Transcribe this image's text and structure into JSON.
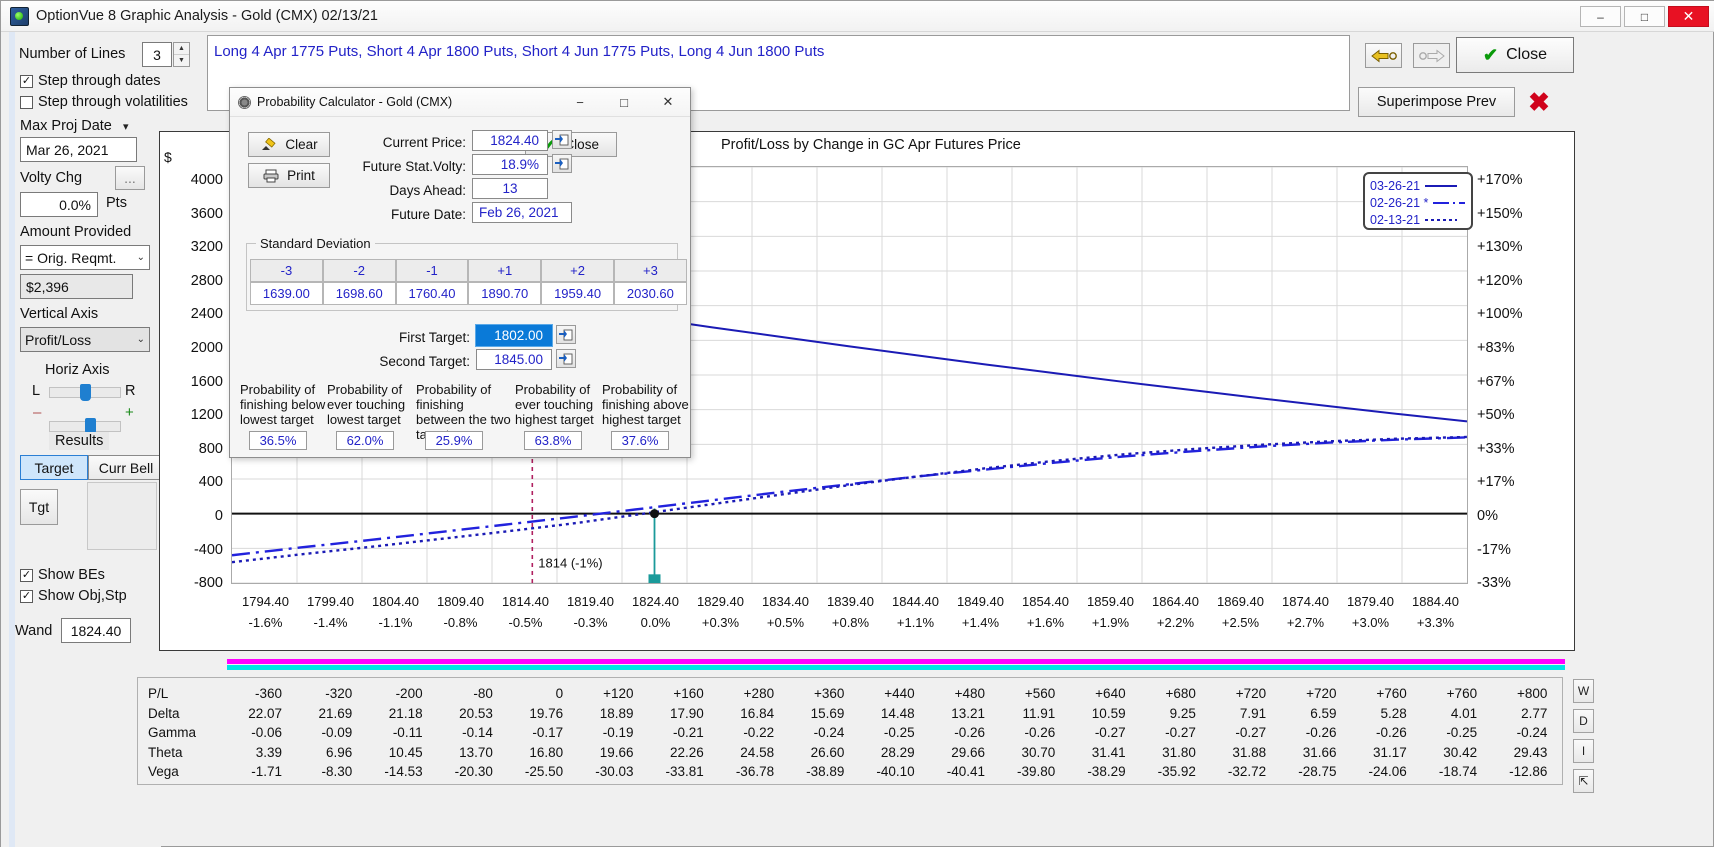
{
  "window": {
    "title": "OptionVue 8 Graphic Analysis - Gold (CMX)  02/13/21",
    "app_icon": "optionvue-icon",
    "minimize": "–",
    "maximize": "□",
    "close": "✕"
  },
  "sidebar": {
    "number_of_lines_label": "Number of Lines",
    "number_of_lines_value": "3",
    "spin_up": "▲",
    "spin_down": "▼",
    "step_dates_label": "Step through dates",
    "step_dates_checked": "✓",
    "step_vol_label": "Step through volatilities",
    "step_vol_checked": "",
    "max_proj_date_label": "Max Proj Date",
    "max_proj_date_caret": "▾",
    "max_proj_date_value": "Mar 26, 2021",
    "volty_chg_label": "Volty Chg",
    "volty_chg_ellipsis": "...",
    "volty_chg_value": "0.0%",
    "pts_label": "Pts",
    "amount_provided_label": "Amount Provided",
    "amount_provided_value": "= Orig. Reqmt.",
    "amount_provided_caret": "⌄",
    "amount_value": "$2,396",
    "vertical_axis_label": "Vertical Axis",
    "vertical_axis_value": "Profit/Loss",
    "vertical_axis_caret": "⌄",
    "horiz_axis_label": "Horiz Axis",
    "horiz_left": "L",
    "horiz_right": "R",
    "zoom_minus": "–",
    "zoom_plus": "+",
    "results_label": "Results",
    "tab_target": "Target",
    "tab_curr_bell": "Curr Bell",
    "tgt_button": "Tgt",
    "show_bes_label": "Show BEs",
    "show_bes_checked": "✓",
    "show_objstp_label": "Show Obj,Stp",
    "show_objstp_checked": "✓",
    "wand_label": "Wand",
    "wand_value": "1824.40"
  },
  "toolbar": {
    "strategy": "Long 4 Apr 1775 Puts, Short 4 Apr 1800 Puts, Short 4 Jun 1775 Puts, Long 4 Jun 1800 Puts",
    "back_icon": "arrow-left-icon",
    "forward_icon": "arrow-right-icon",
    "close_label": "Close",
    "close_check": "✔",
    "superimpose_label": "Superimpose Prev",
    "delete_icon": "✖"
  },
  "dialog": {
    "title": "Probability Calculator - Gold (CMX)",
    "icon": "gear-icon",
    "minimize": "−",
    "maximize": "□",
    "close_x": "✕",
    "clear_label": "Clear",
    "clear_icon": "eraser-icon",
    "print_label": "Print",
    "print_icon": "printer-icon",
    "close_label": "Close",
    "close_check": "✔",
    "fields": [
      {
        "label": "Current Price:",
        "value": "1824.40"
      },
      {
        "label": "Future Stat.Volty:",
        "value": "18.9%"
      },
      {
        "label": "Days Ahead:",
        "value": "13"
      },
      {
        "label": "Future Date:",
        "value": "Feb 26, 2021"
      }
    ],
    "std_dev_group": "Standard Deviation",
    "std_dev_headers": [
      "-3",
      "-2",
      "-1",
      "+1",
      "+2",
      "+3"
    ],
    "std_dev_values": [
      "1639.00",
      "1698.60",
      "1760.40",
      "1890.70",
      "1959.40",
      "2030.60"
    ],
    "first_target_label": "First Target:",
    "first_target_value": "1802.00",
    "second_target_label": "Second Target:",
    "second_target_value": "1845.00",
    "probabilities": [
      {
        "label": "Probability of finishing below lowest target",
        "value": "36.5%"
      },
      {
        "label": "Probability of ever touching lowest target",
        "value": "62.0%"
      },
      {
        "label": "Probability of finishing between the two targets",
        "value": "25.9%"
      },
      {
        "label": "Probability of ever touching highest target",
        "value": "63.8%"
      },
      {
        "label": "Probability of finishing above highest target",
        "value": "37.6%"
      }
    ],
    "copy_icon": "copy-to-field-icon"
  },
  "chart_data": {
    "type": "line",
    "title": "Profit/Loss by Change in GC Apr Futures Price",
    "xlabel": "",
    "ylabel": "$",
    "y_axis_label": "$",
    "y_ticks": [
      "4000",
      "3600",
      "3200",
      "2800",
      "2400",
      "2000",
      "1600",
      "1200",
      "800",
      "400",
      "0",
      "-400",
      "-800"
    ],
    "y_right_ticks": [
      "+170%",
      "+150%",
      "+130%",
      "+120%",
      "+100%",
      "+83%",
      "+67%",
      "+50%",
      "+33%",
      "+17%",
      "0%",
      "-17%",
      "-33%"
    ],
    "ylim": [
      -800,
      4000
    ],
    "x_prices": [
      "1794.40",
      "1799.40",
      "1804.40",
      "1809.40",
      "1814.40",
      "1819.40",
      "1824.40",
      "1829.40",
      "1834.40",
      "1839.40",
      "1844.40",
      "1849.40",
      "1854.40",
      "1859.40",
      "1864.40",
      "1869.40",
      "1874.40",
      "1879.40",
      "1884.40"
    ],
    "x_percents": [
      "-1.6%",
      "-1.4%",
      "-1.1%",
      "-0.8%",
      "-0.5%",
      "-0.3%",
      "0.0%",
      "+0.3%",
      "+0.5%",
      "+0.8%",
      "+1.1%",
      "+1.4%",
      "+1.6%",
      "+1.9%",
      "+2.2%",
      "+2.5%",
      "+2.7%",
      "+3.0%",
      "+3.3%"
    ],
    "legend": [
      {
        "label": "03-26-21",
        "style": "solid"
      },
      {
        "label": "02-26-21 *",
        "style": "dashed"
      },
      {
        "label": "02-13-21",
        "style": "dotted"
      }
    ],
    "legend_position": "top-right",
    "annotation": "1814 (-1%)",
    "marker_price": "1824.40",
    "series": [
      {
        "name": "03-26-21",
        "style": "solid",
        "color": "#1b1bb5",
        "values": [
          3000,
          2870,
          2745,
          2620,
          2500,
          2380,
          2265,
          2150,
          2040,
          1930,
          1825,
          1720,
          1620,
          1520,
          1425,
          1330,
          1240,
          1150,
          1065
        ]
      },
      {
        "name": "02-26-21 *",
        "style": "dashed",
        "color": "#2222dd",
        "values": [
          -480,
          -390,
          -305,
          -215,
          -125,
          -35,
          60,
          155,
          250,
          340,
          430,
          510,
          590,
          660,
          720,
          775,
          820,
          855,
          880
        ]
      },
      {
        "name": "02-13-21",
        "style": "dotted",
        "color": "#1b1bb5",
        "values": [
          -560,
          -470,
          -385,
          -295,
          -205,
          -110,
          0,
          110,
          220,
          330,
          430,
          525,
          610,
          685,
          745,
          795,
          835,
          865,
          885
        ]
      }
    ]
  },
  "data_table": {
    "row_names": [
      "P/L",
      "Delta",
      "Gamma",
      "Theta",
      "Vega"
    ],
    "rows": [
      {
        "name": "P/L",
        "values": [
          "-360",
          "-320",
          "-200",
          "-80",
          "0",
          "+120",
          "+160",
          "+280",
          "+360",
          "+440",
          "+480",
          "+560",
          "+640",
          "+680",
          "+720",
          "+720",
          "+760",
          "+760",
          "+800"
        ]
      },
      {
        "name": "Delta",
        "values": [
          "22.07",
          "21.69",
          "21.18",
          "20.53",
          "19.76",
          "18.89",
          "17.90",
          "16.84",
          "15.69",
          "14.48",
          "13.21",
          "11.91",
          "10.59",
          "9.25",
          "7.91",
          "6.59",
          "5.28",
          "4.01",
          "2.77"
        ]
      },
      {
        "name": "Gamma",
        "values": [
          "-0.06",
          "-0.09",
          "-0.11",
          "-0.14",
          "-0.17",
          "-0.19",
          "-0.21",
          "-0.22",
          "-0.24",
          "-0.25",
          "-0.26",
          "-0.26",
          "-0.27",
          "-0.27",
          "-0.27",
          "-0.26",
          "-0.26",
          "-0.25",
          "-0.24"
        ]
      },
      {
        "name": "Theta",
        "values": [
          "3.39",
          "6.96",
          "10.45",
          "13.70",
          "16.80",
          "19.66",
          "22.26",
          "24.58",
          "26.60",
          "28.29",
          "29.66",
          "30.70",
          "31.41",
          "31.80",
          "31.88",
          "31.66",
          "31.17",
          "30.42",
          "29.43"
        ]
      },
      {
        "name": "Vega",
        "values": [
          "-1.71",
          "-8.30",
          "-14.53",
          "-20.30",
          "-25.50",
          "-30.03",
          "-33.81",
          "-36.78",
          "-38.89",
          "-40.10",
          "-40.41",
          "-39.80",
          "-38.29",
          "-35.92",
          "-32.72",
          "-28.75",
          "-24.06",
          "-18.74",
          "-12.86"
        ]
      }
    ],
    "side_buttons": [
      "W",
      "D",
      "I",
      "⇱"
    ]
  },
  "colors": {
    "accent": "#2323c8",
    "band_magenta": "#ff00ff",
    "band_cyan": "#00e5e5",
    "marker_teal": "#1a9a9a",
    "be_line": "#b02060"
  }
}
